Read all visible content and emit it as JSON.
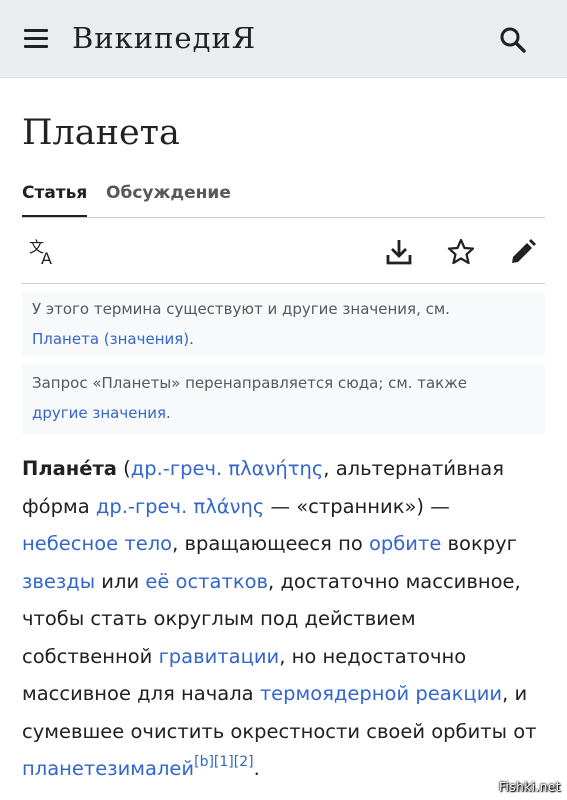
{
  "header": {
    "wordmark": "ВикипедиЯ",
    "menu_icon": "hamburger-menu-icon",
    "search_icon": "search-icon"
  },
  "page": {
    "title": "Планета"
  },
  "tabs": [
    {
      "label": "Статья",
      "active": true
    },
    {
      "label": "Обсуждение",
      "active": false
    }
  ],
  "toolbar": {
    "icons": [
      "translate-icon",
      "download-icon",
      "star-icon",
      "edit-pencil-icon"
    ]
  },
  "hatnotes": [
    {
      "text": "У этого термина существуют и другие значения, см.",
      "link": "Планета (значения)",
      "suffix": "."
    },
    {
      "text": "Запрос «Планеты» перенаправляется сюда; см. также",
      "link": "другие значения",
      "suffix": "."
    }
  ],
  "article": {
    "lead_bold": "Плане́та",
    "p1": " (",
    "link1": "др.-греч. πλανήτης",
    "p2": ", альтернати́вная фо́рма ",
    "link2": "др.-греч. πλάνης",
    "p3": " — «странник») — ",
    "link3": "небесное тело",
    "p4": ", вращающееся по ",
    "link4": "орбите",
    "p5": " вокруг ",
    "link5": "звезды",
    "p6": " или ",
    "link6": "её остатков",
    "p7": ", достаточно массивное, чтобы стать округлым под действием собственной ",
    "link7": "гравитации",
    "p8": ", но недостаточно массивное для начала ",
    "link8": "термоядерной реакции",
    "p9": ", и сумевшее очистить окрестности своей орбиты от ",
    "link9": "планетезималей",
    "refs": [
      "[b]",
      "[1]",
      "[2]"
    ],
    "end": "."
  },
  "watermark": "Fishki.net",
  "colors": {
    "link": "#3366cc",
    "header_bg": "#eaecf0",
    "hatnote_bg": "#f8f9fa",
    "text": "#202122"
  }
}
